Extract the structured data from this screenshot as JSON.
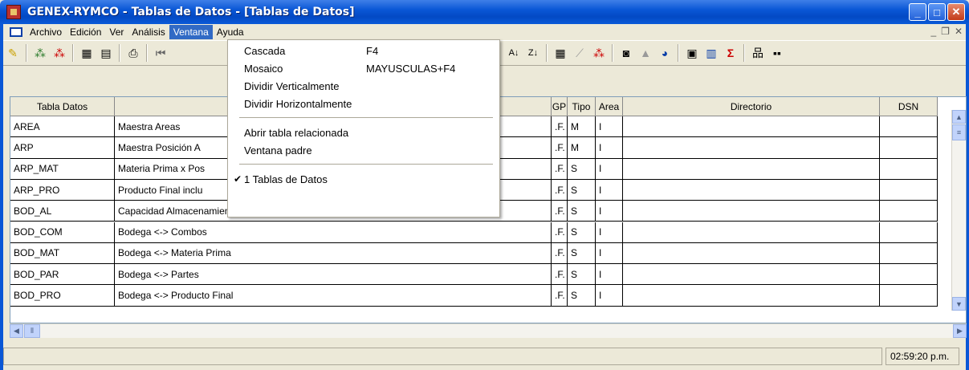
{
  "window": {
    "title": "GENEX-RYMCO - Tablas de Datos - [Tablas de Datos]"
  },
  "menubar": {
    "items": [
      "Archivo",
      "Edición",
      "Ver",
      "Análisis",
      "Ventana",
      "Ayuda"
    ],
    "active": "Ventana"
  },
  "ventana_menu": {
    "items": [
      {
        "label": "Cascada",
        "shortcut": "F4"
      },
      {
        "label": "Mosaico",
        "shortcut": "MAYUSCULAS+F4"
      },
      {
        "label": "Dividir Verticalmente",
        "shortcut": ""
      },
      {
        "label": "Dividir Horizontalmente",
        "shortcut": ""
      },
      {
        "label": "Abrir tabla relacionada",
        "shortcut": ""
      },
      {
        "label": "Ventana padre",
        "shortcut": ""
      },
      {
        "label": "1 Tablas de Datos",
        "shortcut": "",
        "checked": true
      }
    ]
  },
  "grid": {
    "headers": [
      "Tabla Datos",
      "",
      "GP",
      "Tipo",
      "Area",
      "Directorio",
      "DSN"
    ],
    "rows": [
      [
        "AREA",
        "Maestra Areas",
        ".F.",
        "M",
        "I",
        "",
        ""
      ],
      [
        "ARP",
        "Maestra Posición A",
        ".F.",
        "M",
        "I",
        "",
        ""
      ],
      [
        "ARP_MAT",
        "Materia Prima x Pos",
        ".F.",
        "S",
        "I",
        "",
        ""
      ],
      [
        "ARP_PRO",
        "Producto Final inclu",
        ".F.",
        "S",
        "I",
        "",
        ""
      ],
      [
        "BOD_AL",
        "Capacidad Almacenamiento Partes x Período",
        ".F.",
        "S",
        "I",
        "",
        ""
      ],
      [
        "BOD_COM",
        "Bodega <-> Combos",
        ".F.",
        "S",
        "I",
        "",
        ""
      ],
      [
        "BOD_MAT",
        "Bodega <-> Materia Prima",
        ".F.",
        "S",
        "I",
        "",
        ""
      ],
      [
        "BOD_PAR",
        "Bodega <-> Partes",
        ".F.",
        "S",
        "I",
        "",
        ""
      ],
      [
        "BOD_PRO",
        "Bodega <-> Producto Final",
        ".F.",
        "S",
        "I",
        "",
        ""
      ]
    ]
  },
  "status": {
    "time": "02:59:20 p.m."
  },
  "colors": {
    "titlebar": "#0a57d6",
    "menu_highlight": "#316ac5"
  }
}
